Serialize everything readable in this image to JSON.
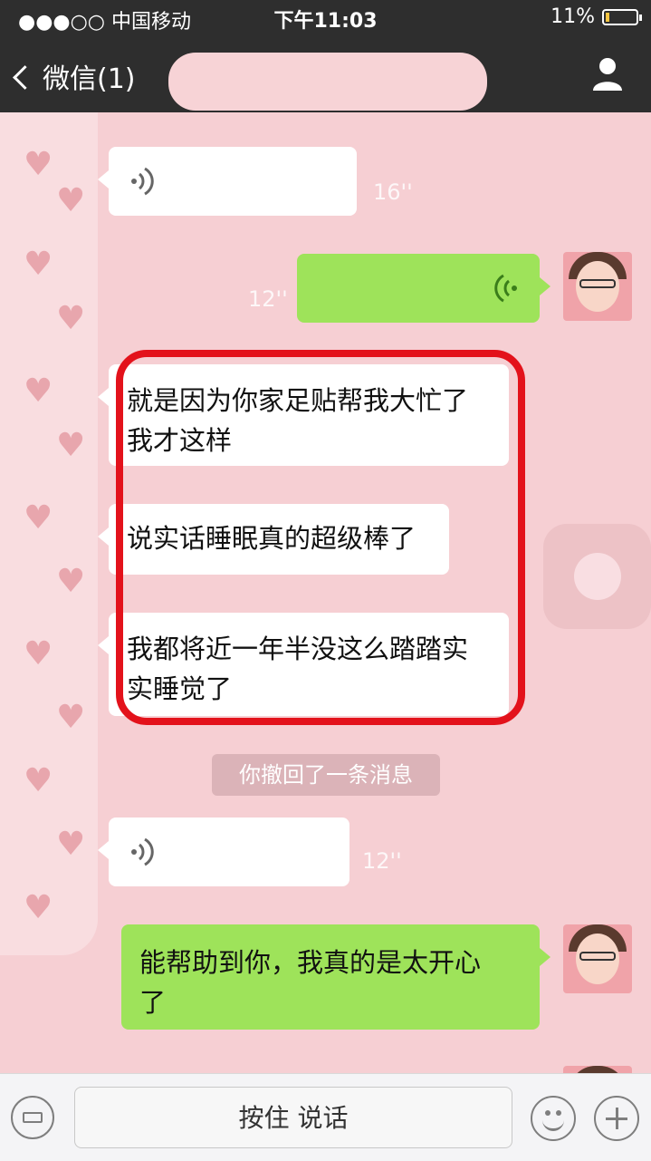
{
  "status_bar": {
    "carrier": "●●●○○ 中国移动",
    "time": "下午11:03",
    "battery_pct": "11%"
  },
  "nav": {
    "back_label": "微信(1)",
    "profile_icon": "person-icon"
  },
  "messages": [
    {
      "type": "voice",
      "side": "received",
      "duration": "16''"
    },
    {
      "type": "voice",
      "side": "sent",
      "duration": "12''"
    },
    {
      "type": "text",
      "side": "received",
      "text_line1": "就是因为你家足贴帮我大忙了",
      "text_line2": "我才这样"
    },
    {
      "type": "text",
      "side": "received",
      "text_line1": "说实话睡眠真的超级棒了"
    },
    {
      "type": "text",
      "side": "received",
      "text_line1": "我都将近一年半没这么踏踏实",
      "text_line2": "实睡觉了"
    },
    {
      "type": "notice",
      "text": "你撤回了一条消息"
    },
    {
      "type": "voice",
      "side": "received",
      "duration": "12''"
    },
    {
      "type": "text",
      "side": "sent",
      "text_line1": "能帮助到你，我真的是太开心",
      "text_line2": "了"
    }
  ],
  "input_bar": {
    "talk_label": "按住 说话",
    "icons": [
      "keyboard-icon",
      "emoji-icon",
      "plus-icon"
    ]
  },
  "colors": {
    "sent_bubble": "#9ee35a",
    "highlight_frame": "#e3121b",
    "chat_background": "#f6cfd3"
  }
}
